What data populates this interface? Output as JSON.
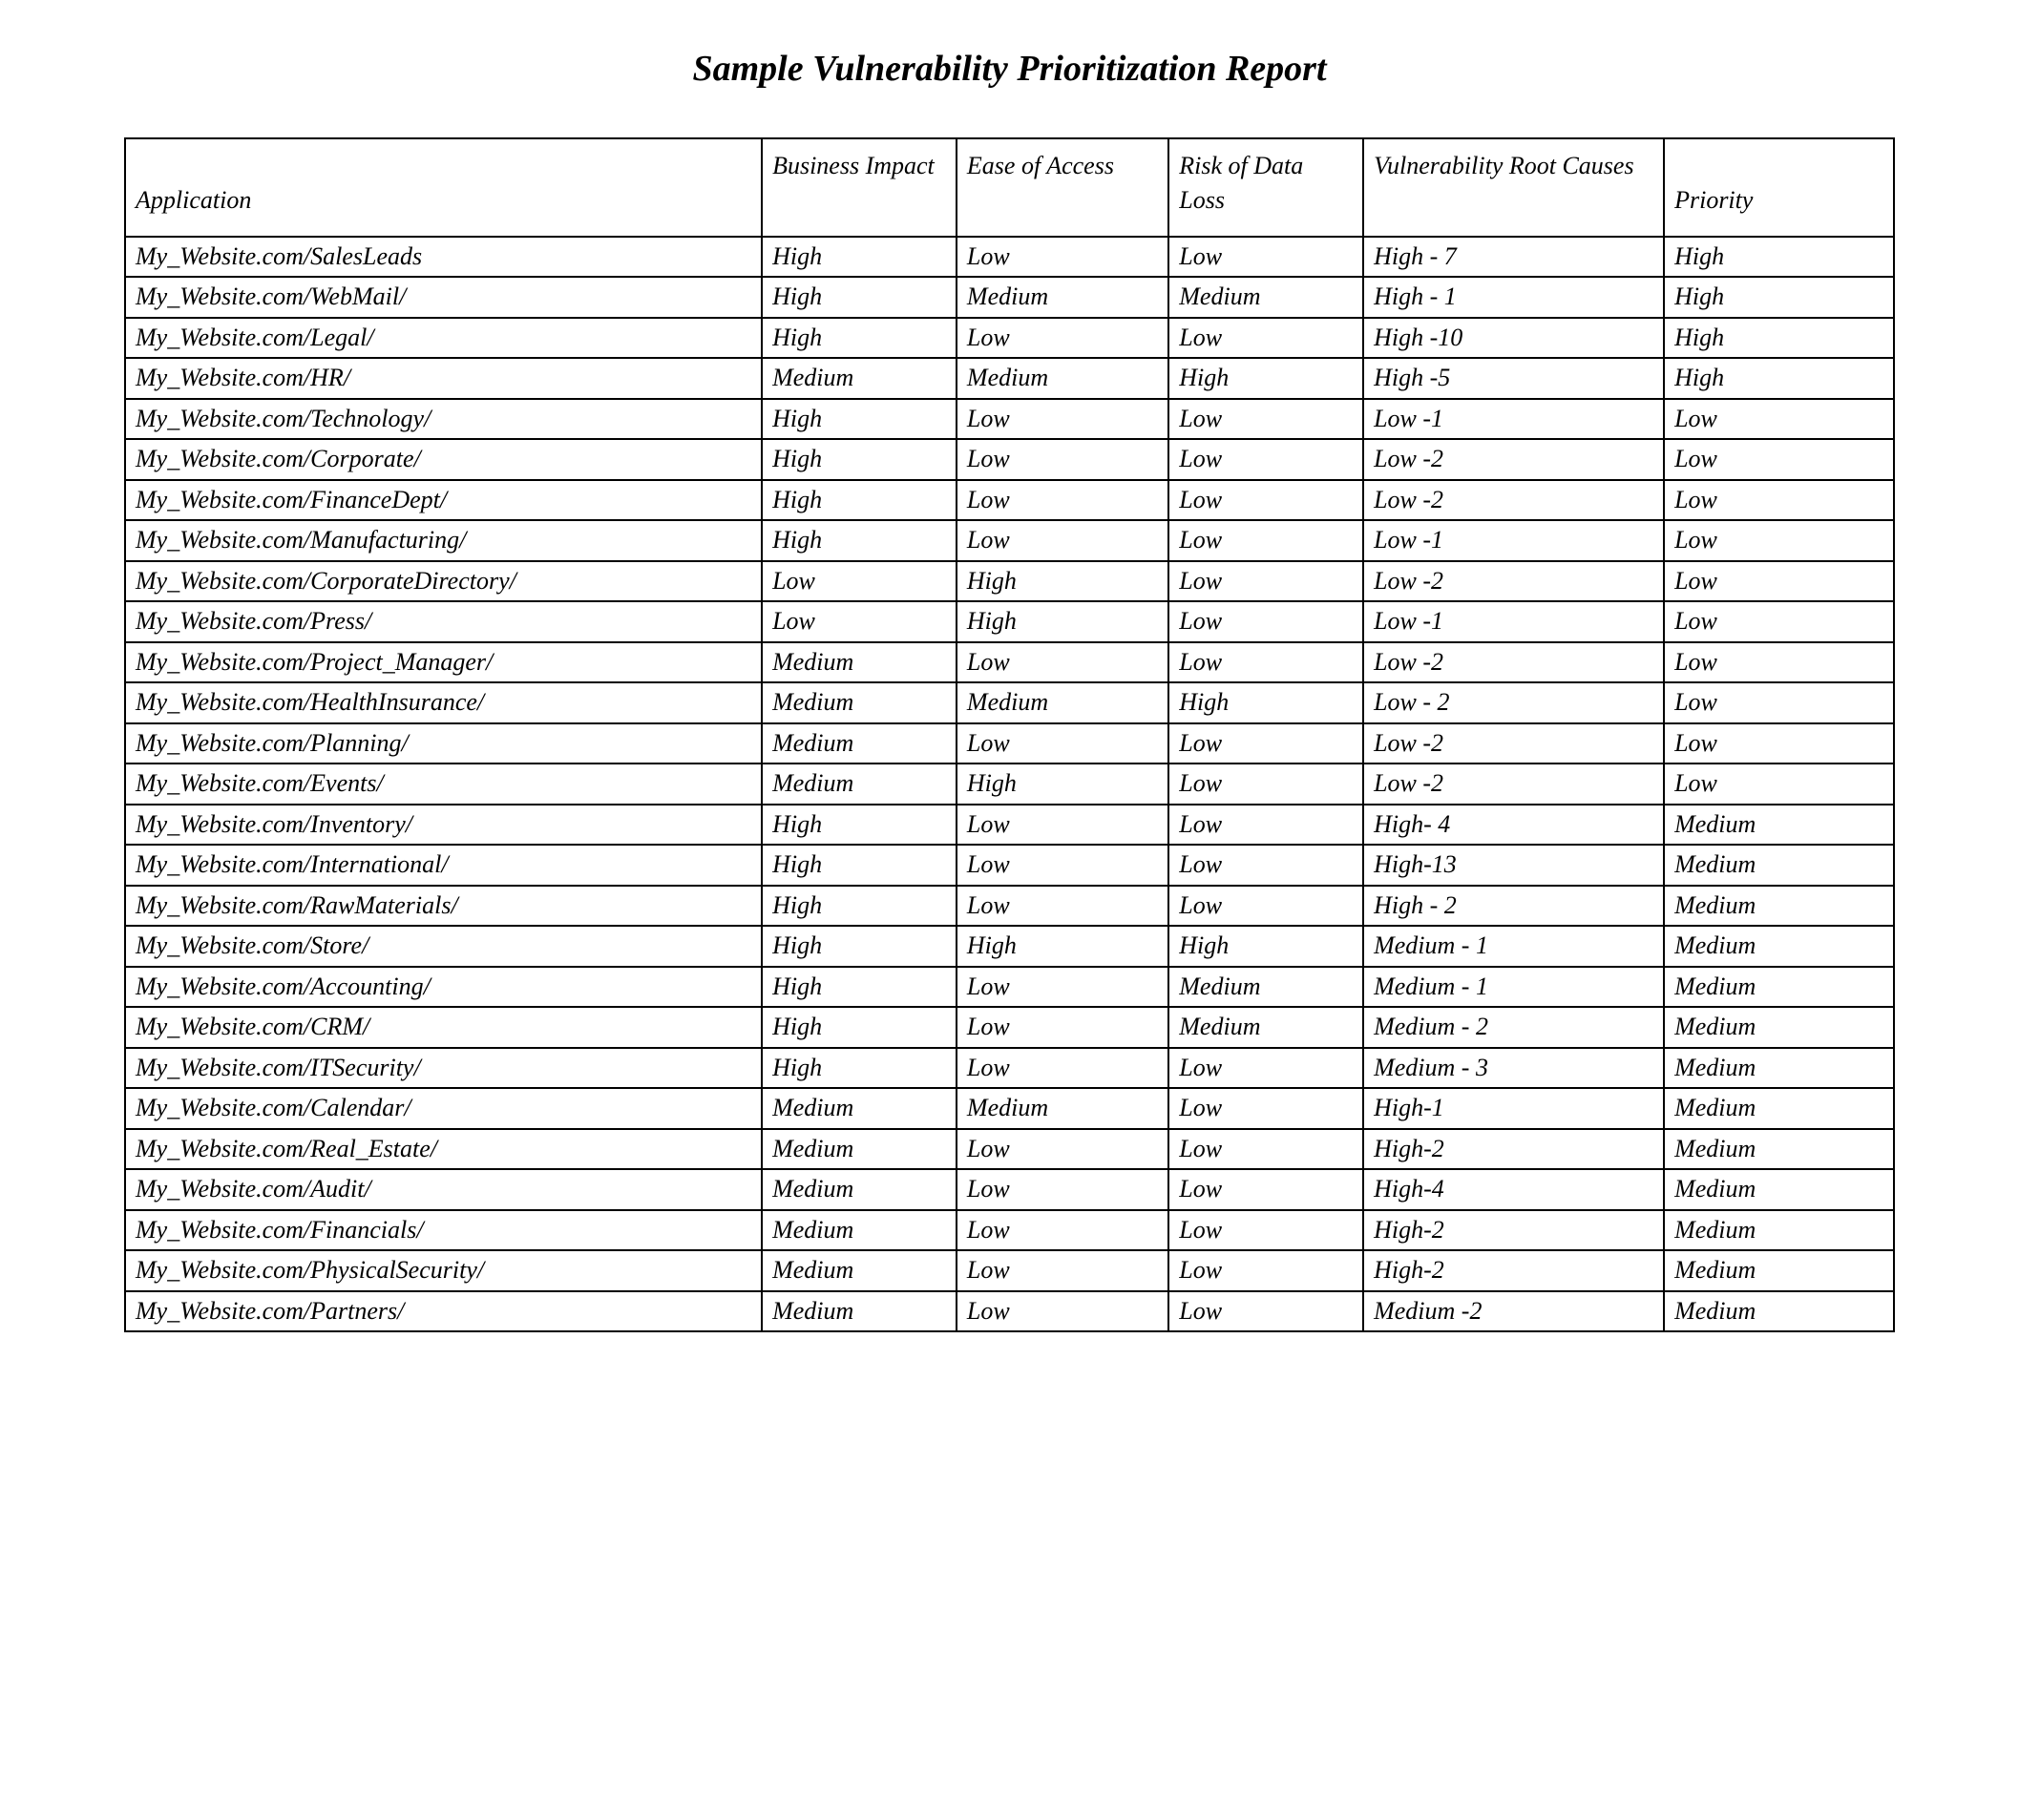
{
  "title": "Sample Vulnerability Prioritization Report",
  "headers": {
    "application": "Application",
    "impact": "Business Impact",
    "access": "Ease of Access",
    "risk": "Risk of Data Loss",
    "root": "Vulnerability Root Causes",
    "priority": "Priority"
  },
  "rows": [
    {
      "app": "My_Website.com/SalesLeads",
      "impact": "High",
      "access": "Low",
      "risk": "Low",
      "root": "High - 7",
      "priority": "High"
    },
    {
      "app": "My_Website.com/WebMail/",
      "impact": "High",
      "access": "Medium",
      "risk": "Medium",
      "root": "High - 1",
      "priority": "High"
    },
    {
      "app": "My_Website.com/Legal/",
      "impact": "High",
      "access": "Low",
      "risk": "Low",
      "root": "High -10",
      "priority": "High"
    },
    {
      "app": "My_Website.com/HR/",
      "impact": "Medium",
      "access": "Medium",
      "risk": "High",
      "root": "High -5",
      "priority": "High"
    },
    {
      "app": "My_Website.com/Technology/",
      "impact": "High",
      "access": "Low",
      "risk": "Low",
      "root": "Low -1",
      "priority": "Low"
    },
    {
      "app": "My_Website.com/Corporate/",
      "impact": "High",
      "access": "Low",
      "risk": "Low",
      "root": "Low -2",
      "priority": "Low"
    },
    {
      "app": "My_Website.com/FinanceDept/",
      "impact": "High",
      "access": "Low",
      "risk": "Low",
      "root": "Low -2",
      "priority": "Low"
    },
    {
      "app": "My_Website.com/Manufacturing/",
      "impact": "High",
      "access": "Low",
      "risk": "Low",
      "root": "Low -1",
      "priority": "Low"
    },
    {
      "app": "My_Website.com/CorporateDirectory/",
      "impact": "Low",
      "access": "High",
      "risk": "Low",
      "root": "Low -2",
      "priority": "Low"
    },
    {
      "app": "My_Website.com/Press/",
      "impact": "Low",
      "access": "High",
      "risk": "Low",
      "root": "Low -1",
      "priority": "Low"
    },
    {
      "app": "My_Website.com/Project_Manager/",
      "impact": "Medium",
      "access": "Low",
      "risk": "Low",
      "root": "Low -2",
      "priority": "Low"
    },
    {
      "app": "My_Website.com/HealthInsurance/",
      "impact": "Medium",
      "access": "Medium",
      "risk": "High",
      "root": "Low - 2",
      "priority": "Low"
    },
    {
      "app": "My_Website.com/Planning/",
      "impact": "Medium",
      "access": "Low",
      "risk": "Low",
      "root": "Low -2",
      "priority": "Low"
    },
    {
      "app": "My_Website.com/Events/",
      "impact": "Medium",
      "access": "High",
      "risk": "Low",
      "root": "Low -2",
      "priority": "Low"
    },
    {
      "app": "My_Website.com/Inventory/",
      "impact": "High",
      "access": "Low",
      "risk": "Low",
      "root": "High- 4",
      "priority": "Medium"
    },
    {
      "app": "My_Website.com/International/",
      "impact": "High",
      "access": "Low",
      "risk": "Low",
      "root": "High-13",
      "priority": "Medium"
    },
    {
      "app": "My_Website.com/RawMaterials/",
      "impact": "High",
      "access": "Low",
      "risk": "Low",
      "root": "High - 2",
      "priority": "Medium"
    },
    {
      "app": "My_Website.com/Store/",
      "impact": "High",
      "access": "High",
      "risk": "High",
      "root": "Medium - 1",
      "priority": "Medium"
    },
    {
      "app": "My_Website.com/Accounting/",
      "impact": "High",
      "access": "Low",
      "risk": "Medium",
      "root": "Medium - 1",
      "priority": "Medium"
    },
    {
      "app": "My_Website.com/CRM/",
      "impact": "High",
      "access": "Low",
      "risk": "Medium",
      "root": "Medium - 2",
      "priority": "Medium"
    },
    {
      "app": "My_Website.com/ITSecurity/",
      "impact": "High",
      "access": "Low",
      "risk": "Low",
      "root": "Medium - 3",
      "priority": "Medium"
    },
    {
      "app": "My_Website.com/Calendar/",
      "impact": "Medium",
      "access": "Medium",
      "risk": "Low",
      "root": "High-1",
      "priority": "Medium"
    },
    {
      "app": "My_Website.com/Real_Estate/",
      "impact": "Medium",
      "access": "Low",
      "risk": "Low",
      "root": "High-2",
      "priority": "Medium"
    },
    {
      "app": "My_Website.com/Audit/",
      "impact": "Medium",
      "access": "Low",
      "risk": "Low",
      "root": "High-4",
      "priority": "Medium"
    },
    {
      "app": "My_Website.com/Financials/",
      "impact": "Medium",
      "access": "Low",
      "risk": "Low",
      "root": "High-2",
      "priority": "Medium"
    },
    {
      "app": "My_Website.com/PhysicalSecurity/",
      "impact": "Medium",
      "access": "Low",
      "risk": "Low",
      "root": "High-2",
      "priority": "Medium"
    },
    {
      "app": "My_Website.com/Partners/",
      "impact": "Medium",
      "access": "Low",
      "risk": "Low",
      "root": "Medium -2",
      "priority": "Medium"
    }
  ]
}
